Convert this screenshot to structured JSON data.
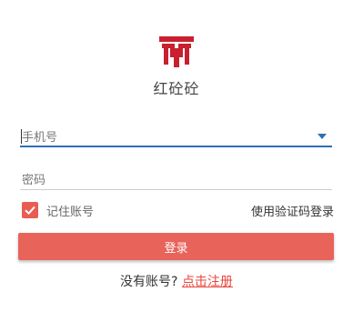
{
  "app": {
    "name": "红砼砼",
    "brand_color": "#c8202f"
  },
  "login_form": {
    "phone_placeholder": "手机号",
    "phone_value": "",
    "password_placeholder": "密码",
    "password_value": "",
    "remember_label": "记住账号",
    "remember_checked": true,
    "sms_login_label": "使用验证码登录",
    "submit_label": "登录",
    "accent_color": "#e8635a"
  },
  "register": {
    "prompt": "没有账号?",
    "link_label": "点击注册"
  },
  "icons": {
    "logo": "brand-logo",
    "dropdown": "chevron-down-icon",
    "checkbox": "checkmark-icon"
  }
}
